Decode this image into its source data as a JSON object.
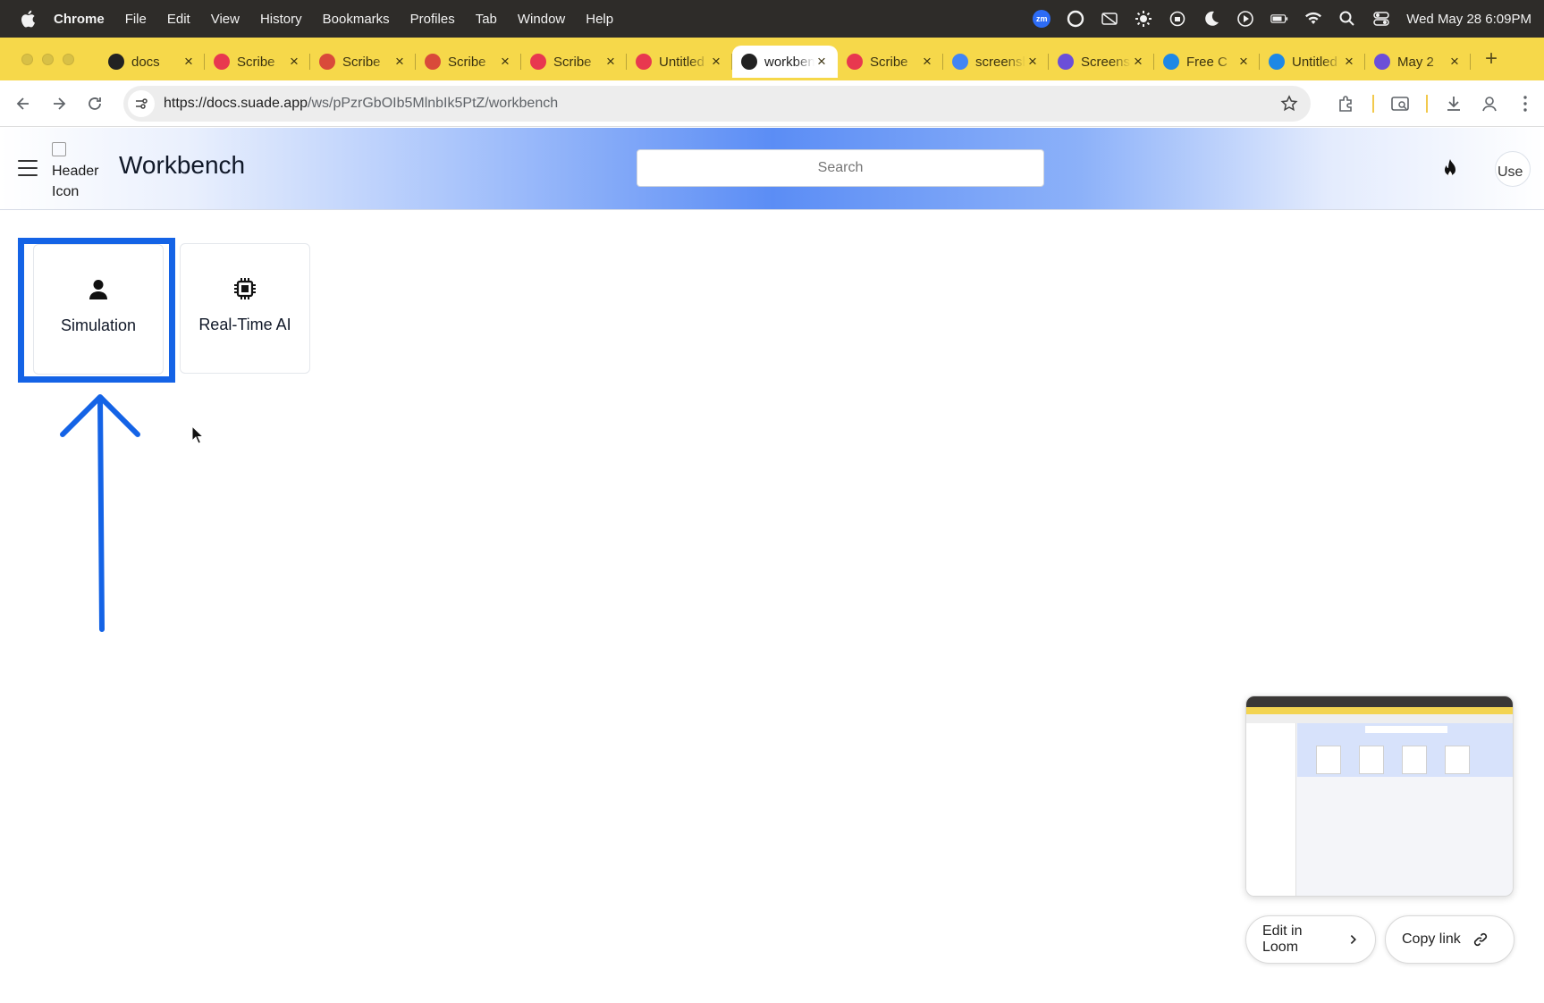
{
  "menubar": {
    "items": [
      "Chrome",
      "File",
      "Edit",
      "View",
      "History",
      "Bookmarks",
      "Profiles",
      "Tab",
      "Window",
      "Help"
    ],
    "status_zoom": "zm",
    "datetime": "Wed May 28  6:09PM"
  },
  "browser": {
    "tabs": [
      {
        "label": "docs",
        "icon": "suade-icon",
        "color": "#222222",
        "active": false
      },
      {
        "label": "Scribe",
        "icon": "scribe-icon",
        "color": "#e8384f",
        "active": false
      },
      {
        "label": "Scribe",
        "icon": "rainbow-icon",
        "color": "#d94a3a",
        "active": false
      },
      {
        "label": "Scribe",
        "icon": "rainbow-icon",
        "color": "#d94a3a",
        "active": false
      },
      {
        "label": "Scribe",
        "icon": "scribe-icon",
        "color": "#e8384f",
        "active": false
      },
      {
        "label": "Untitled",
        "icon": "scribe-icon",
        "color": "#e8384f",
        "active": false
      },
      {
        "label": "workbench",
        "icon": "suade-icon",
        "color": "#222222",
        "active": true
      },
      {
        "label": "Scribe",
        "icon": "scribe-icon",
        "color": "#e8384f",
        "active": false
      },
      {
        "label": "screenshot",
        "icon": "google-icon",
        "color": "#4285f4",
        "active": false
      },
      {
        "label": "Screenshot",
        "icon": "gear-icon",
        "color": "#6b4fd8",
        "active": false
      },
      {
        "label": "Free C",
        "icon": "canva-icon",
        "color": "#1e88e5",
        "active": false
      },
      {
        "label": "Untitled",
        "icon": "canva-icon",
        "color": "#1e88e5",
        "active": false
      },
      {
        "label": "May 2",
        "icon": "gear-icon",
        "color": "#6b4fd8",
        "active": false
      }
    ],
    "url_host": "https://docs.suade.app",
    "url_path": "/ws/pPzrGbOIb5MlnbIk5PtZ/workbench"
  },
  "app": {
    "header_icon_alt": "Header Icon",
    "title": "Workbench",
    "search_placeholder": "Search",
    "user_avatar_alt": "Use"
  },
  "cards": [
    {
      "label": "Simulation",
      "icon": "user-icon"
    },
    {
      "label": "Real-Time AI",
      "icon": "chip-icon"
    }
  ],
  "loom": {
    "edit_label": "Edit in Loom",
    "copy_label": "Copy link"
  },
  "colors": {
    "highlight": "#1463e6",
    "tabstrip": "#f6d84a",
    "header_gradient_center": "#5b8df5"
  }
}
